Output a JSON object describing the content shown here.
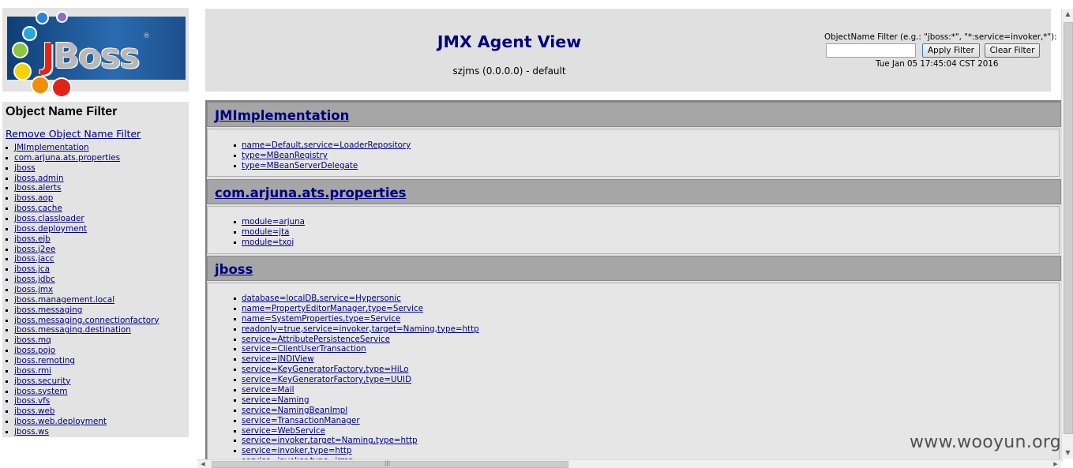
{
  "logo": {
    "word_j": "J",
    "word_rest": "Boss",
    "registered": "®"
  },
  "sidebar": {
    "title": "Object Name Filter",
    "remove_filter": "Remove Object Name Filter",
    "domains": [
      "JMImplementation",
      "com.arjuna.ats.properties",
      "jboss",
      "jboss.admin",
      "jboss.alerts",
      "jboss.aop",
      "jboss.cache",
      "jboss.classloader",
      "jboss.deployment",
      "jboss.ejb",
      "jboss.j2ee",
      "jboss.jacc",
      "jboss.jca",
      "jboss.jdbc",
      "jboss.jmx",
      "jboss.management.local",
      "jboss.messaging",
      "jboss.messaging.connectionfactory",
      "jboss.messaging.destination",
      "jboss.mq",
      "jboss.pojo",
      "jboss.remoting",
      "jboss.rmi",
      "jboss.security",
      "jboss.system",
      "jboss.vfs",
      "jboss.web",
      "jboss.web.deployment",
      "jboss.ws"
    ]
  },
  "header": {
    "title": "JMX Agent View",
    "server": "szjms (0.0.0.0) - default",
    "filter_label": "ObjectName Filter (e.g.: \"jboss:*\", \"*:service=invoker,*\"):",
    "filter_value": "",
    "apply_label": "Apply Filter",
    "clear_label": "Clear Filter",
    "timestamp": "Tue Jan 05 17:45:04 CST 2016"
  },
  "sections": [
    {
      "domain": "JMImplementation",
      "mbeans": [
        "name=Default,service=LoaderRepository",
        "type=MBeanRegistry",
        "type=MBeanServerDelegate"
      ]
    },
    {
      "domain": "com.arjuna.ats.properties",
      "mbeans": [
        "module=arjuna",
        "module=jta",
        "module=txoj"
      ]
    },
    {
      "domain": "jboss",
      "mbeans": [
        "database=localDB,service=Hypersonic",
        "name=PropertyEditorManager,type=Service",
        "name=SystemProperties,type=Service",
        "readonly=true,service=invoker,target=Naming,type=http",
        "service=AttributePersistenceService",
        "service=ClientUserTransaction",
        "service=JNDIView",
        "service=KeyGeneratorFactory,type=HiLo",
        "service=KeyGeneratorFactory,type=UUID",
        "service=Mail",
        "service=Naming",
        "service=NamingBeanImpl",
        "service=TransactionManager",
        "service=WebService",
        "service=invoker,target=Naming,type=http",
        "service=invoker,type=http",
        "service=invoker,type=jrmp"
      ]
    }
  ],
  "watermark": "www.wooyun.org",
  "colors": {
    "link": "#000080",
    "header_bg": "#e0e0e0",
    "domain_bar": "#a6a6a6"
  }
}
